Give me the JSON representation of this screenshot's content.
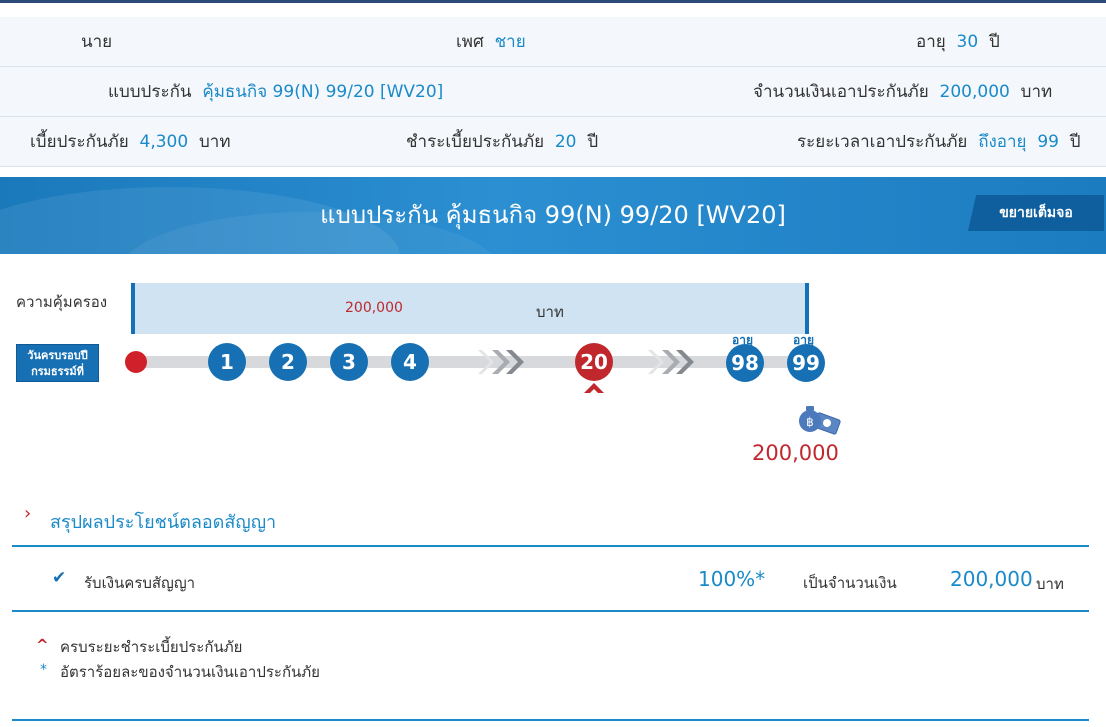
{
  "info": {
    "title_prefix": "นาย",
    "gender_label": "เพศ",
    "gender_value": "ชาย",
    "age_label": "อายุ",
    "age_value": "30",
    "age_unit": "ปี",
    "plan_label": "แบบประกัน",
    "plan_value": "คุ้มธนกิจ 99(N) 99/20 [WV20]",
    "sum_insured_label": "จำนวนเงินเอาประกันภัย",
    "sum_insured_value": "200,000",
    "sum_insured_unit": "บาท",
    "premium_label": "เบี้ยประกันภัย",
    "premium_value": "4,300",
    "premium_unit": "บาท",
    "pay_term_label": "ชำระเบี้ยประกันภัย",
    "pay_term_value": "20",
    "pay_term_unit": "ปี",
    "coverage_term_label": "ระยะเวลาเอาประกันภัย",
    "coverage_term_value": "ถึงอายุ",
    "coverage_term_age": "99",
    "coverage_term_unit": "ปี"
  },
  "banner": {
    "title": "แบบประกัน คุ้มธนกิจ 99(N) 99/20 [WV20]",
    "expand_label": "ขยายเต็มจอ"
  },
  "timeline": {
    "coverage_label": "ความคุ้มครอง",
    "coverage_amount": "200,000",
    "coverage_unit": "บาท",
    "anniversary_line1": "วันครบรอบปี",
    "anniversary_line2": "กรมธรรม์ที่",
    "years": [
      "1",
      "2",
      "3",
      "4",
      "20",
      "98",
      "99"
    ],
    "age_tag": "อายุ",
    "payout_amount": "200,000"
  },
  "summary": {
    "title": "สรุปผลประโยชน์ตลอดสัญญา",
    "benefit_label": "รับเงินครบสัญญา",
    "benefit_percent": "100%*",
    "benefit_as_label": "เป็นจำนวนเงิน",
    "benefit_amount": "200,000",
    "benefit_unit": "บาท"
  },
  "notes": {
    "note1": "ครบระยะชำระเบี้ยประกันภัย",
    "note2": "อัตราร้อยละของจำนวนเงินเอาประกันภัย"
  },
  "colors": {
    "accent": "#1a8ac9",
    "brand_blue": "#1670b3",
    "highlight_red": "#c0282d"
  }
}
